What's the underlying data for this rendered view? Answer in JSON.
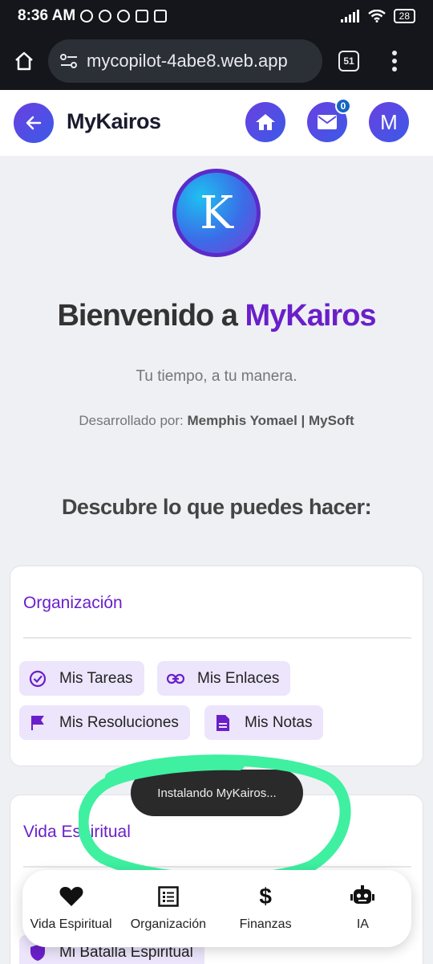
{
  "status_bar": {
    "time": "8:36 AM",
    "battery": "28"
  },
  "browser": {
    "url": "mycopilot-4abe8.web.app",
    "tab_count": "51"
  },
  "header": {
    "title": "MyKairos",
    "mail_badge": "0",
    "avatar_initial": "M"
  },
  "hero": {
    "logo_letter": "K",
    "welcome_prefix": "Bienvenido a ",
    "welcome_brand": "MyKairos",
    "tagline": "Tu tiempo, a tu manera.",
    "dev_label": "Desarrollado por:",
    "dev_name": "Memphis Yomael | MySoft"
  },
  "section_title": "Descubre lo que puedes hacer:",
  "cards": {
    "org": {
      "title": "Organización",
      "chips": [
        "Mis Tareas",
        "Mis Enlaces",
        "Mis Resoluciones",
        "Mis Notas"
      ]
    },
    "vida": {
      "title": "Vida Espiritual",
      "chips": [
        "Mi Batalla Espiritual"
      ]
    }
  },
  "toast": "Instalando MyKairos...",
  "bottom_nav": [
    "Vida Espiritual",
    "Organización",
    "Finanzas",
    "IA"
  ],
  "colors": {
    "accent": "#6a1fc9",
    "chip_bg": "#ece5fb",
    "annotation": "#3ef0a0"
  }
}
